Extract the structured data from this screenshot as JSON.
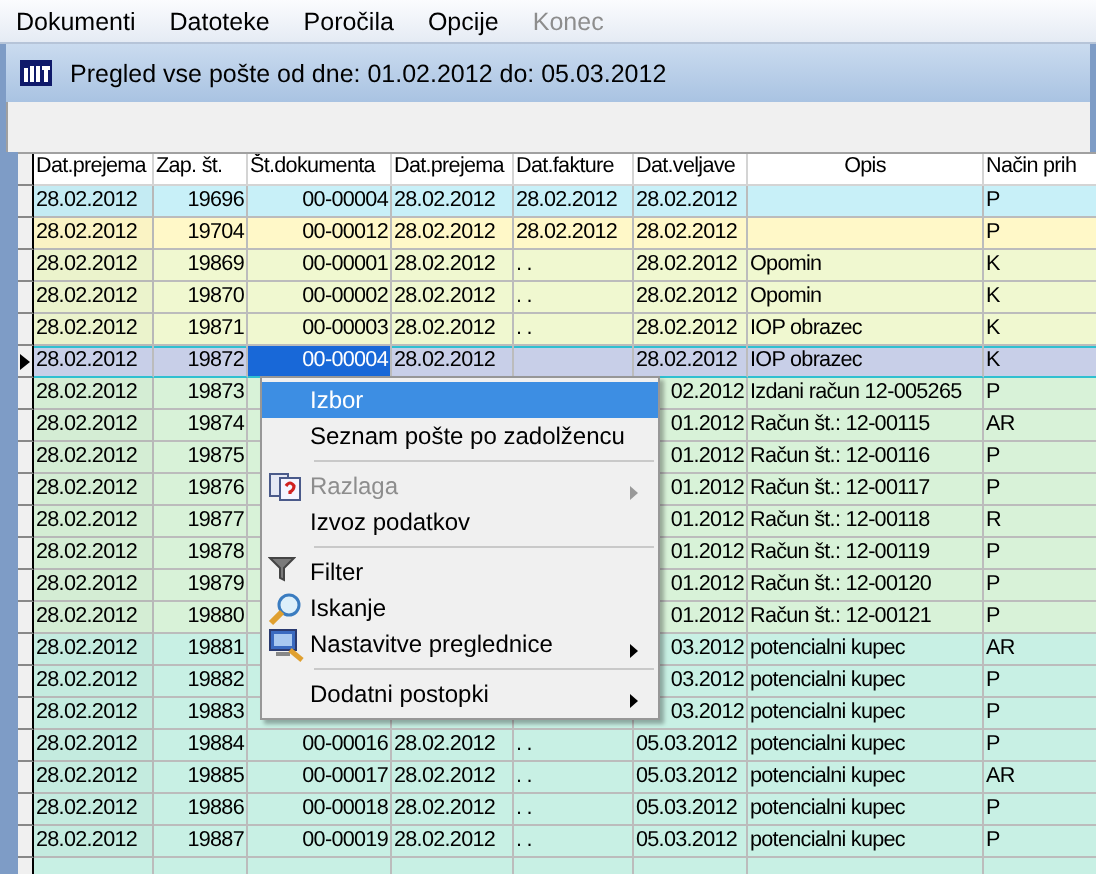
{
  "menu_bar": [
    {
      "label": "Dokumenti",
      "disabled": false
    },
    {
      "label": "Datoteke",
      "disabled": false
    },
    {
      "label": "Poročila",
      "disabled": false
    },
    {
      "label": "Opcije",
      "disabled": false
    },
    {
      "label": "Konec",
      "disabled": true
    }
  ],
  "title": "Pregled vse pošte od dne: 01.02.2012 do: 05.03.2012",
  "table": {
    "columns": [
      "Dat.prejema",
      "Zap. št.",
      "Št.dokumenta",
      "Dat.prejema",
      "Dat.fakture",
      "Dat.veljave",
      "Opis",
      "Način prih"
    ],
    "rows": [
      {
        "color": "#c8f0f8",
        "selected": false,
        "covered": false,
        "cells": [
          "28.02.2012",
          "19696",
          "00-00004",
          "28.02.2012",
          "28.02.2012",
          "28.02.2012",
          "",
          "P"
        ]
      },
      {
        "color": "#fff8c8",
        "selected": false,
        "covered": false,
        "cells": [
          "28.02.2012",
          "19704",
          "00-00012",
          "28.02.2012",
          "28.02.2012",
          "28.02.2012",
          "",
          "P"
        ]
      },
      {
        "color": "#f0f8d0",
        "selected": false,
        "covered": false,
        "cells": [
          "28.02.2012",
          "19869",
          "00-00001",
          "28.02.2012",
          ". .",
          "28.02.2012",
          "Opomin",
          "K"
        ]
      },
      {
        "color": "#f0f8d0",
        "selected": false,
        "covered": false,
        "cells": [
          "28.02.2012",
          "19870",
          "00-00002",
          "28.02.2012",
          ". .",
          "28.02.2012",
          "Opomin",
          "K"
        ]
      },
      {
        "color": "#f0f8d0",
        "selected": false,
        "covered": false,
        "cells": [
          "28.02.2012",
          "19871",
          "00-00003",
          "28.02.2012",
          ". .",
          "28.02.2012",
          "IOP obrazec",
          "K"
        ]
      },
      {
        "color": "#c8cfe8",
        "selected": true,
        "covered": false,
        "cells": [
          "28.02.2012",
          "19872",
          "00-00004",
          "28.02.2012",
          "",
          "28.02.2012",
          "IOP obrazec",
          "K"
        ]
      },
      {
        "color": "#d8f2d8",
        "selected": false,
        "covered": true,
        "cells": [
          "28.02.2012",
          "19873",
          null,
          null,
          null,
          "02.2012",
          "Izdani račun 12-005265",
          "P"
        ]
      },
      {
        "color": "#d8f2d8",
        "selected": false,
        "covered": true,
        "cells": [
          "28.02.2012",
          "19874",
          null,
          null,
          null,
          "01.2012",
          "Račun št.: 12-00115",
          "AR"
        ]
      },
      {
        "color": "#d8f2d8",
        "selected": false,
        "covered": true,
        "cells": [
          "28.02.2012",
          "19875",
          null,
          null,
          null,
          "01.2012",
          "Račun št.: 12-00116",
          "P"
        ]
      },
      {
        "color": "#d8f2d8",
        "selected": false,
        "covered": true,
        "cells": [
          "28.02.2012",
          "19876",
          null,
          null,
          null,
          "01.2012",
          "Račun št.: 12-00117",
          "P"
        ]
      },
      {
        "color": "#d8f2d8",
        "selected": false,
        "covered": true,
        "cells": [
          "28.02.2012",
          "19877",
          null,
          null,
          null,
          "01.2012",
          "Račun št.: 12-00118",
          "R"
        ]
      },
      {
        "color": "#d8f2d8",
        "selected": false,
        "covered": true,
        "cells": [
          "28.02.2012",
          "19878",
          null,
          null,
          null,
          "01.2012",
          "Račun št.: 12-00119",
          "P"
        ]
      },
      {
        "color": "#d8f2d8",
        "selected": false,
        "covered": true,
        "cells": [
          "28.02.2012",
          "19879",
          null,
          null,
          null,
          "01.2012",
          "Račun št.: 12-00120",
          "P"
        ]
      },
      {
        "color": "#d8f2d8",
        "selected": false,
        "covered": true,
        "cells": [
          "28.02.2012",
          "19880",
          null,
          null,
          null,
          "01.2012",
          "Račun št.: 12-00121",
          "P"
        ]
      },
      {
        "color": "#c8f0e4",
        "selected": false,
        "covered": true,
        "cells": [
          "28.02.2012",
          "19881",
          null,
          null,
          null,
          "03.2012",
          "potencialni kupec",
          "AR"
        ]
      },
      {
        "color": "#c8f0e4",
        "selected": false,
        "covered": true,
        "cells": [
          "28.02.2012",
          "19882",
          null,
          null,
          null,
          "03.2012",
          "potencialni kupec",
          "P"
        ]
      },
      {
        "color": "#c8f0e4",
        "selected": false,
        "covered": true,
        "cells": [
          "28.02.2012",
          "19883",
          null,
          null,
          null,
          "03.2012",
          "potencialni kupec",
          "P"
        ]
      },
      {
        "color": "#c8f0e4",
        "selected": false,
        "covered": false,
        "cells": [
          "28.02.2012",
          "19884",
          "00-00016",
          "28.02.2012",
          ". .",
          "05.03.2012",
          "potencialni kupec",
          "P"
        ]
      },
      {
        "color": "#c8f0e4",
        "selected": false,
        "covered": false,
        "cells": [
          "28.02.2012",
          "19885",
          "00-00017",
          "28.02.2012",
          ". .",
          "05.03.2012",
          "potencialni kupec",
          "AR"
        ]
      },
      {
        "color": "#c8f0e4",
        "selected": false,
        "covered": false,
        "cells": [
          "28.02.2012",
          "19886",
          "00-00018",
          "28.02.2012",
          ". .",
          "05.03.2012",
          "potencialni kupec",
          "P"
        ]
      },
      {
        "color": "#c8f0e4",
        "selected": false,
        "covered": false,
        "cells": [
          "28.02.2012",
          "19887",
          "00-00019",
          "28.02.2012",
          ". .",
          "05.03.2012",
          "potencialni kupec",
          "P"
        ]
      }
    ]
  },
  "context_menu": [
    {
      "kind": "item",
      "label": "Izbor",
      "selected": true,
      "disabled": false,
      "submenu": false
    },
    {
      "kind": "item",
      "label": "Seznam pošte po zadolžencu",
      "selected": false,
      "disabled": false,
      "submenu": false
    },
    {
      "kind": "separator"
    },
    {
      "kind": "item",
      "label": "Razlaga",
      "selected": false,
      "disabled": true,
      "submenu": true
    },
    {
      "kind": "item",
      "label": "Izvoz podatkov",
      "selected": false,
      "disabled": false,
      "submenu": false
    },
    {
      "kind": "separator"
    },
    {
      "kind": "item",
      "label": "Filter",
      "selected": false,
      "disabled": false,
      "submenu": false
    },
    {
      "kind": "item",
      "label": "Iskanje",
      "selected": false,
      "disabled": false,
      "submenu": false
    },
    {
      "kind": "item",
      "label": "Nastavitve preglednice",
      "selected": false,
      "disabled": false,
      "submenu": true
    },
    {
      "kind": "separator"
    },
    {
      "kind": "item",
      "label": "Dodatni postopki",
      "selected": false,
      "disabled": false,
      "submenu": true
    }
  ]
}
